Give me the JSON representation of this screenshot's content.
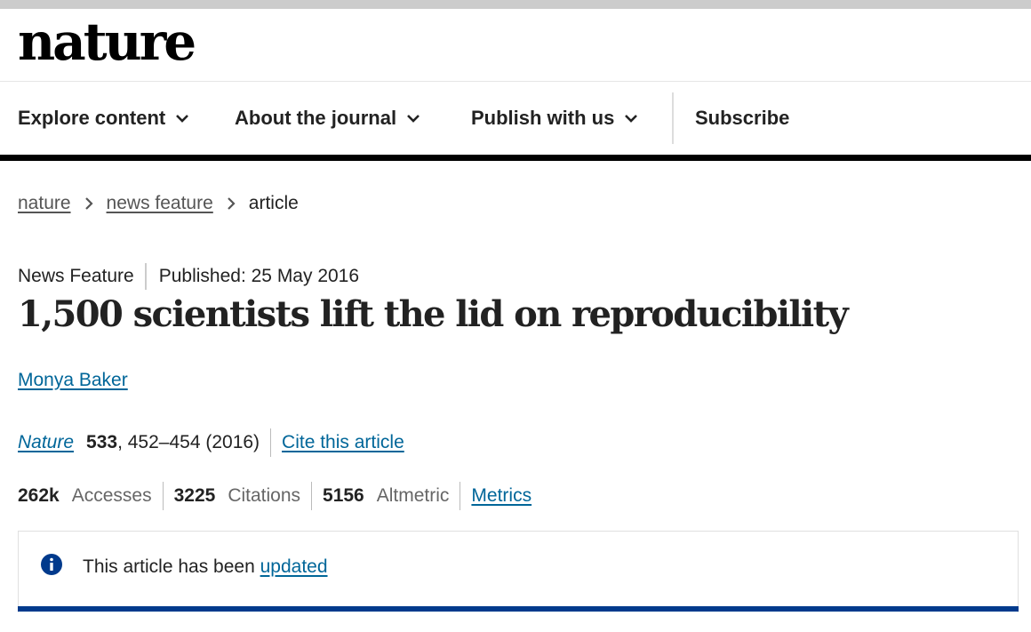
{
  "brand": {
    "logo": "nature"
  },
  "nav": {
    "items": [
      {
        "label": "Explore content"
      },
      {
        "label": "About the journal"
      },
      {
        "label": "Publish with us"
      }
    ],
    "subscribe": "Subscribe"
  },
  "breadcrumb": {
    "items": [
      "nature",
      "news feature"
    ],
    "current": "article"
  },
  "article": {
    "type": "News Feature",
    "published": "Published: 25 May 2016",
    "title": "1,500 scientists lift the lid on reproducibility",
    "author": "Monya Baker",
    "citation": {
      "journal": "Nature",
      "volume": "533",
      "pages": ", 452–454 (2016)",
      "cite_link": "Cite this article"
    },
    "metrics": {
      "accesses_value": "262k",
      "accesses_label": "Accesses",
      "citations_value": "3225",
      "citations_label": "Citations",
      "altmetric_value": "5156",
      "altmetric_label": "Altmetric",
      "metrics_link": "Metrics"
    },
    "notice": {
      "text": "This article has been ",
      "link": "updated"
    }
  },
  "colors": {
    "link": "#006699",
    "notice_accent": "#003a8c",
    "info_icon": "#003a8c"
  }
}
